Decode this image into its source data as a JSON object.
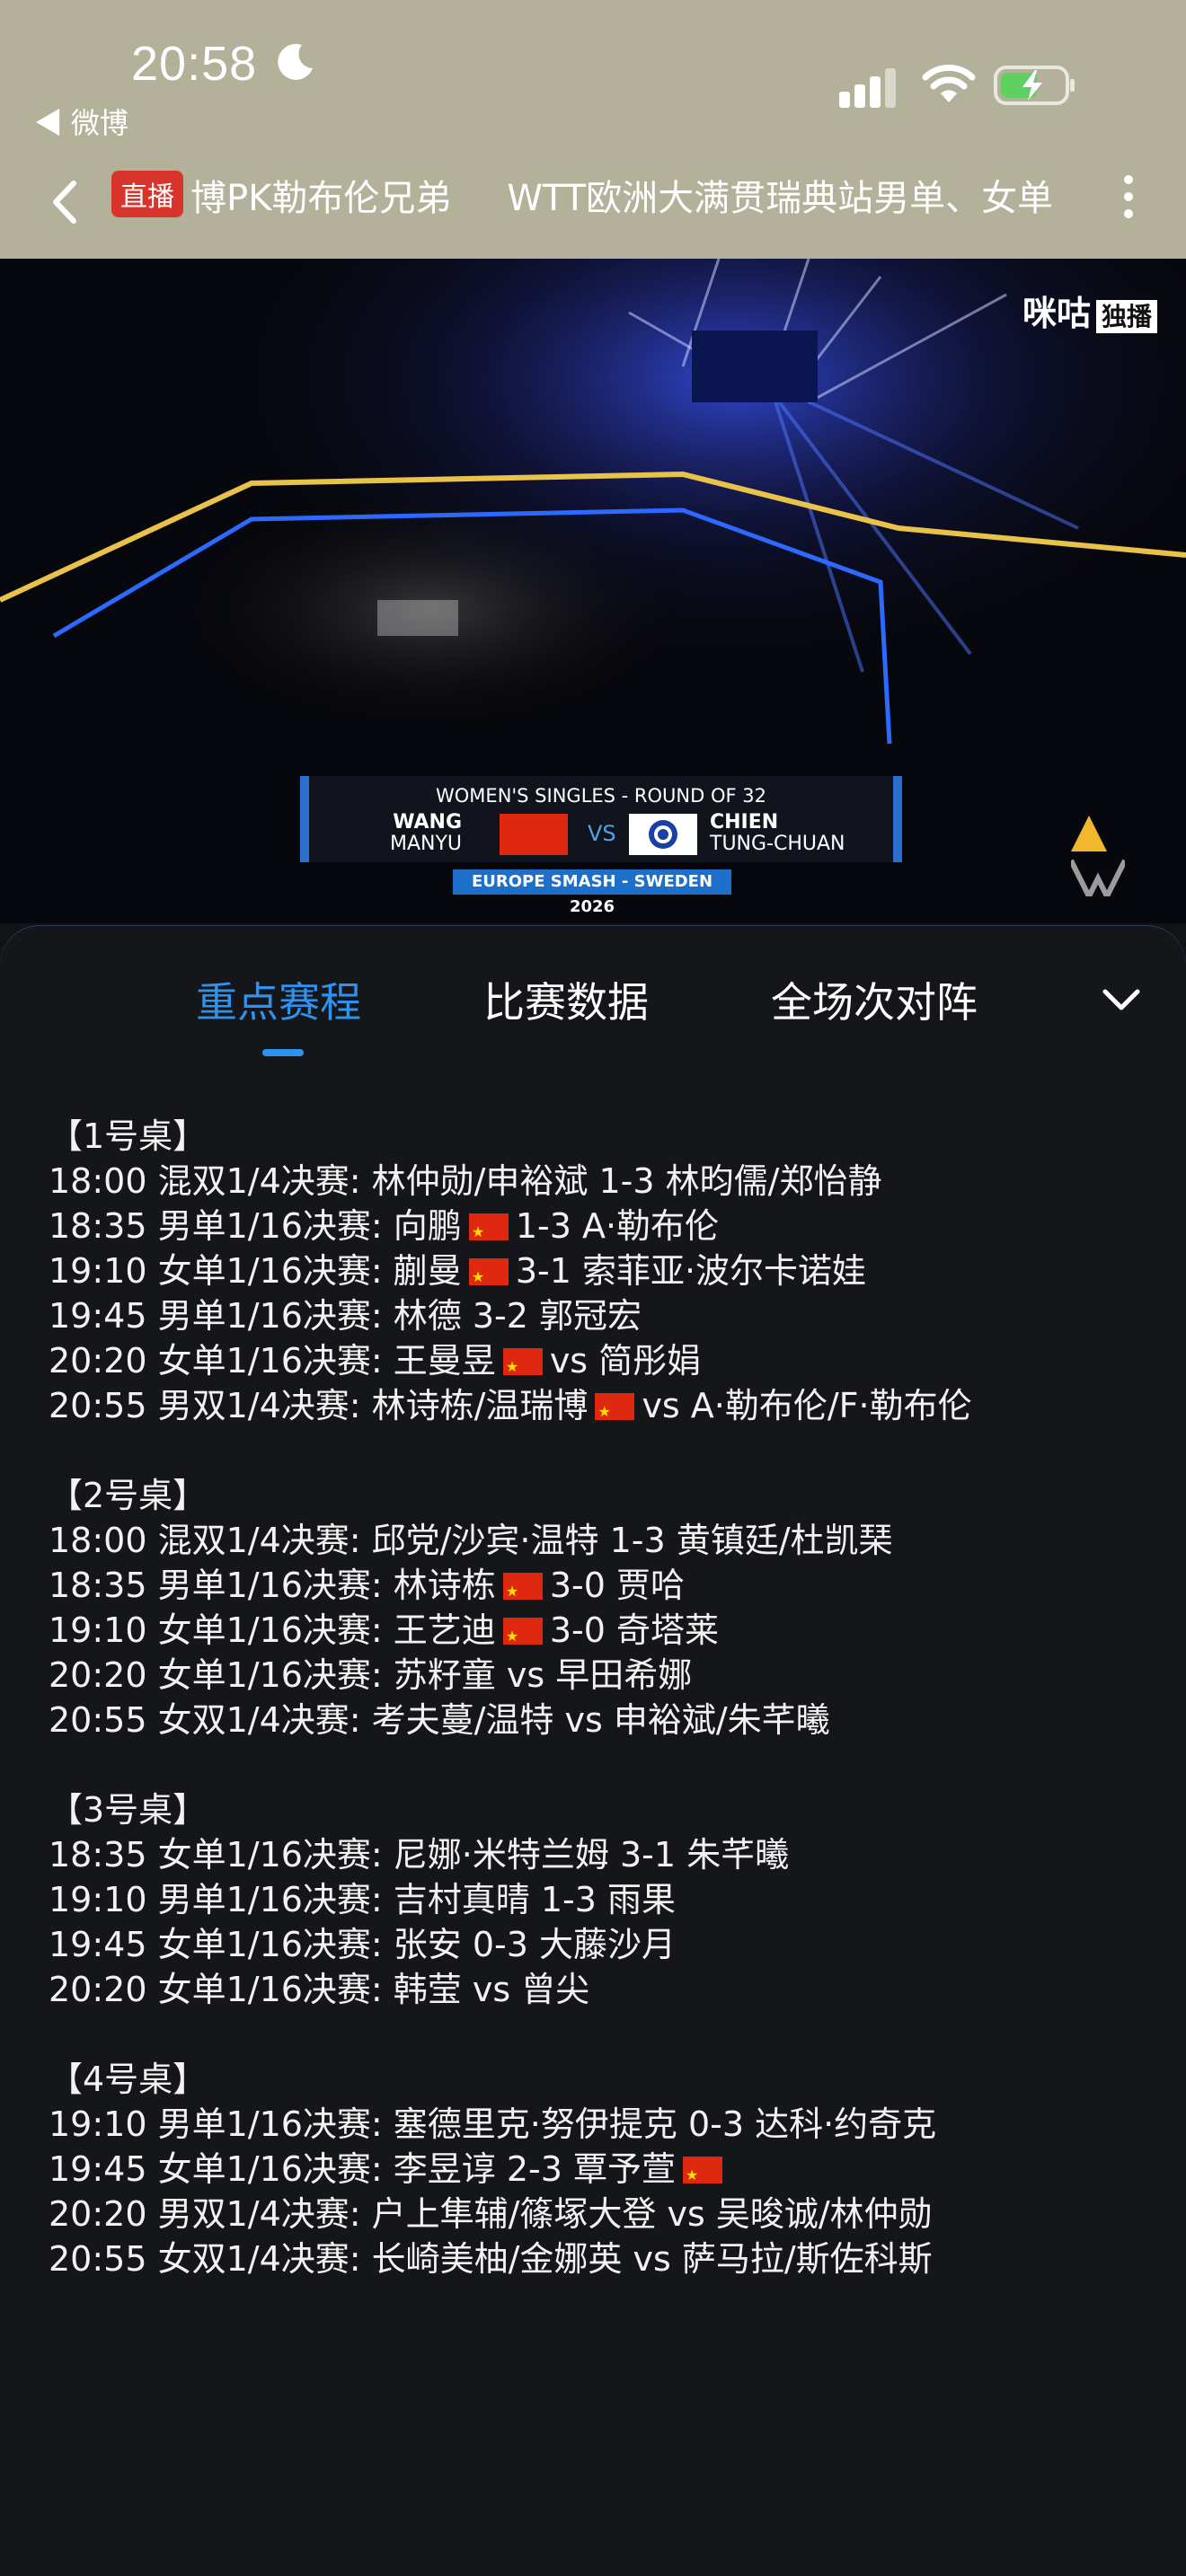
{
  "status_bar": {
    "time": "20:58",
    "back_app": "◀ 微博"
  },
  "title_bar": {
    "live_badge": "直播",
    "marquee_segments": [
      "博PK勒布伦兄弟",
      "WTT欧洲大满贯瑞典站男单、女单"
    ]
  },
  "video": {
    "watermark": "咪咕",
    "watermark_tag": "独播",
    "scoreboard": {
      "title": "WOMEN'S SINGLES - ROUND OF 32",
      "player1_last": "WANG",
      "player1_first": "MANYU",
      "vs": "VS",
      "player2_last": "CHIEN",
      "player2_first": "TUNG-CHUAN",
      "event": "EUROPE SMASH - SWEDEN 2026"
    }
  },
  "tabs": [
    "重点赛程",
    "比赛数据",
    "全场次对阵"
  ],
  "schedule": [
    {
      "title": "【1号桌】",
      "matches": [
        {
          "pre": "18:00 混双1/4决赛:  林仲勋/申裕斌 1-3 林昀儒/郑怡静",
          "flag": false,
          "post": ""
        },
        {
          "pre": "18:35 男单1/16决赛:  向鹏",
          "flag": true,
          "post": "1-3 A·勒布伦"
        },
        {
          "pre": "19:10 女单1/16决赛:  蒯曼",
          "flag": true,
          "post": "3-1 索菲亚·波尔卡诺娃"
        },
        {
          "pre": "19:45 男单1/16决赛:  林德 3-2 郭冠宏",
          "flag": false,
          "post": ""
        },
        {
          "pre": "20:20 女单1/16决赛:  王曼昱",
          "flag": true,
          "post": "vs 简彤娟"
        },
        {
          "pre": "20:55 男双1/4决赛:  林诗栋/温瑞博",
          "flag": true,
          "post": "vs A·勒布伦/F·勒布伦"
        }
      ]
    },
    {
      "title": "【2号桌】",
      "matches": [
        {
          "pre": "18:00 混双1/4决赛:  邱党/沙宾·温特 1-3 黄镇廷/杜凯琹",
          "flag": false,
          "post": ""
        },
        {
          "pre": "18:35 男单1/16决赛:  林诗栋",
          "flag": true,
          "post": "3-0 贾哈"
        },
        {
          "pre": "19:10 女单1/16决赛:  王艺迪",
          "flag": true,
          "post": "3-0 奇塔莱"
        },
        {
          "pre": "20:20 女单1/16决赛:  苏籽童 vs 早田希娜",
          "flag": false,
          "post": ""
        },
        {
          "pre": "20:55 女双1/4决赛:  考夫蔓/温特 vs 申裕斌/朱芊曦",
          "flag": false,
          "post": ""
        }
      ]
    },
    {
      "title": "【3号桌】",
      "matches": [
        {
          "pre": "18:35 女单1/16决赛:  尼娜·米特兰姆 3-1 朱芊曦",
          "flag": false,
          "post": ""
        },
        {
          "pre": "19:10 男单1/16决赛:  吉村真晴 1-3 雨果",
          "flag": false,
          "post": ""
        },
        {
          "pre": "19:45 女单1/16决赛:  张安 0-3 大藤沙月",
          "flag": false,
          "post": ""
        },
        {
          "pre": "20:20 女单1/16决赛:  韩莹 vs 曾尖",
          "flag": false,
          "post": ""
        }
      ]
    },
    {
      "title": "【4号桌】",
      "matches": [
        {
          "pre": "19:10 男单1/16决赛:  塞德里克·努伊提克 0-3 达科·约奇克",
          "flag": false,
          "post": ""
        },
        {
          "pre": "19:45 女单1/16决赛:  李昱谆 2-3 覃予萱",
          "flag": true,
          "post": ""
        },
        {
          "pre": "20:20 男双1/4决赛:  户上隼辅/篠塚大登 vs 吴晙诚/林仲勋",
          "flag": false,
          "post": ""
        },
        {
          "pre": "20:55 女双1/4决赛:  长崎美柚/金娜英 vs 萨马拉/斯佐科斯",
          "flag": false,
          "post": ""
        }
      ]
    }
  ],
  "colors": {
    "accent": "#2d93ef",
    "header_bg": "#b3b19a",
    "live_red": "#d9342b",
    "flag_red": "#de2910"
  }
}
